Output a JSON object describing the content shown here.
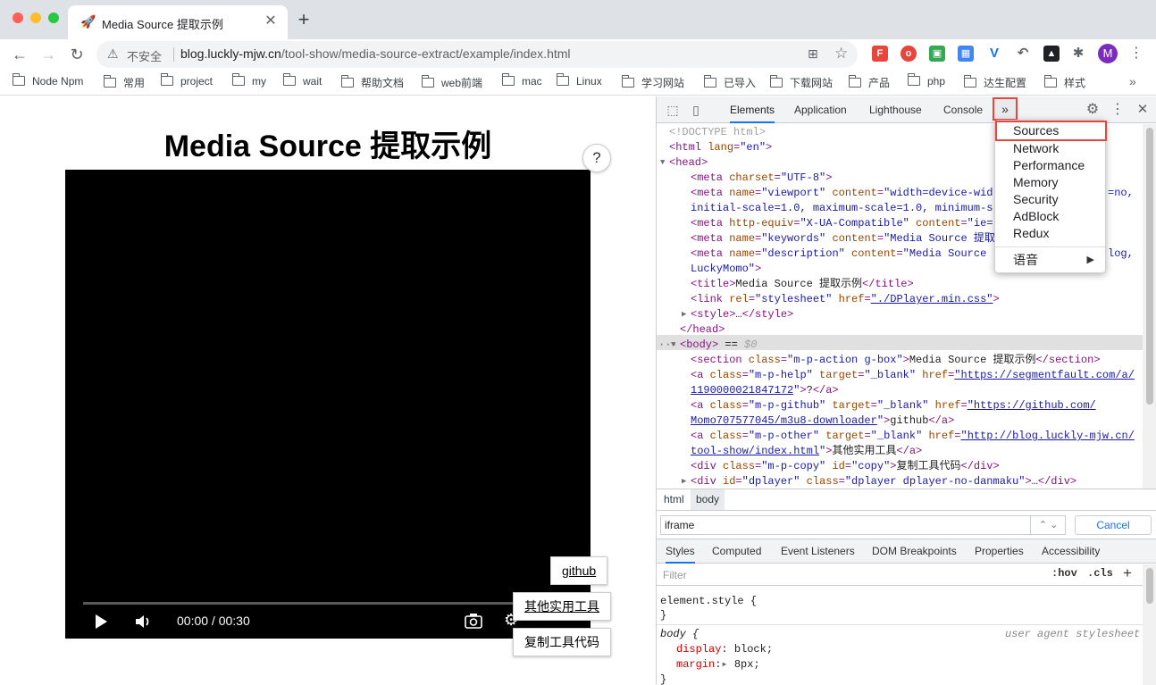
{
  "browser": {
    "tab_title": "Media Source 提取示例",
    "new_tab": "+",
    "close_tab": "✕",
    "address": {
      "security_label": "不安全",
      "url_host": "blog.luckly-mjw.cn",
      "url_path": "/tool-show/media-source-extract/example/index.html"
    },
    "profile_initial": "M",
    "bookmarks": [
      "Node Npm",
      "常用",
      "project",
      "my",
      "wait",
      "帮助文档",
      "web前端",
      "mac",
      "Linux",
      "学习网站",
      "已导入",
      "下载网站",
      "产品",
      "php",
      "达生配置",
      "样式"
    ],
    "bookmarks_more": "»"
  },
  "page": {
    "title": "Media Source 提取示例",
    "help_label": "?",
    "player": {
      "time": "00:00 / 00:30",
      "progress": 0
    },
    "buttons": {
      "github": "github",
      "other_tools": "其他实用工具",
      "copy_code": "复制工具代码"
    }
  },
  "devtools": {
    "tabs": [
      "Elements",
      "Application",
      "Lighthouse",
      "Console"
    ],
    "active_tab": "Elements",
    "overflow_label": "»",
    "overflow_menu": [
      "Sources",
      "Network",
      "Performance",
      "Memory",
      "Security",
      "AdBlock",
      "Redux"
    ],
    "overflow_submenu": "语音",
    "dom_lines": [
      {
        "t": "<!DOCTYPE html>"
      },
      {
        "t": "<html lang=\"en\">"
      },
      {
        "t": "<head>"
      },
      {
        "t": "<meta charset=\"UTF-8\">"
      },
      {
        "t": "<meta name=\"viewport\" content=\"width=device-wid"
      },
      {
        "t": "=no,"
      },
      {
        "t": "initial-scale=1.0, maximum-scale=1.0, minimum-s"
      },
      {
        "t": "<meta http-equiv=\"X-UA-Compatible\" content=\"ie="
      },
      {
        "t": "<meta name=\"keywords\" content=\"Media Source 提取"
      },
      {
        "t": "<meta name=\"description\" content=\"Media Source"
      },
      {
        "t": "log,"
      },
      {
        "t": "LuckyMomo\">"
      },
      {
        "t": "<title>Media Source 提取示例</title>"
      },
      {
        "t": "<link rel=\"stylesheet\" href=\"./DPlayer.min.css\">"
      },
      {
        "t": "<style>…</style>"
      },
      {
        "t": "</head>"
      },
      {
        "t": "<body> == $0"
      },
      {
        "t": "<section class=\"m-p-action g-box\">Media Source 提取示例</section>"
      },
      {
        "t": "<a class=\"m-p-help\" target=\"_blank\" href=\"https://segmentfault.com/a/"
      },
      {
        "t": "1190000021847172\">?</a>"
      },
      {
        "t": "<a class=\"m-p-github\" target=\"_blank\" href=\"https://github.com/"
      },
      {
        "t": "Momo707577045/m3u8-downloader\">github</a>"
      },
      {
        "t": "<a class=\"m-p-other\" target=\"_blank\" href=\"http://blog.luckly-mjw.cn/"
      },
      {
        "t": "tool-show/index.html\">其他实用工具</a>"
      },
      {
        "t": "<div class=\"m-p-copy\" id=\"copy\">复制工具代码</div>"
      },
      {
        "t": "<div id=\"dplayer\" class=\"dplayer dplayer-no-danmaku\">…</div>"
      }
    ],
    "breadcrumbs": [
      "html",
      "body"
    ],
    "search": {
      "value": "iframe",
      "cancel": "Cancel"
    },
    "style_tabs": [
      "Styles",
      "Computed",
      "Event Listeners",
      "DOM Breakpoints",
      "Properties",
      "Accessibility"
    ],
    "filter_placeholder": "Filter",
    "hov": ":hov",
    "cls": ".cls",
    "add": "+",
    "rules": {
      "element_style": "element.style {",
      "close": "}",
      "body_selector": "body {",
      "ua_label": "user agent stylesheet",
      "display_prop": "display",
      "display_val": "block;",
      "margin_prop": "margin",
      "margin_val": "8px;"
    }
  }
}
